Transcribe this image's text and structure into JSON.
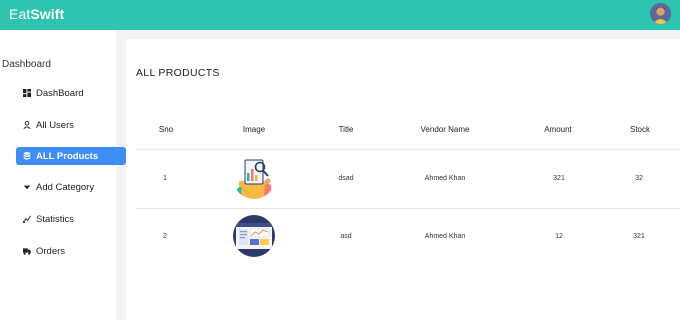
{
  "header": {
    "brand_prefix": "Eat",
    "brand_suffix": "Swift",
    "accent_color": "#2ec4b0"
  },
  "sidebar": {
    "heading": "Dashboard",
    "items": [
      {
        "label": "DashBoard",
        "icon": "grid-icon",
        "active": false
      },
      {
        "label": "All Users",
        "icon": "user-icon",
        "active": false
      },
      {
        "label": "ALL Products",
        "icon": "database-icon",
        "active": true
      },
      {
        "label": "Add Category",
        "icon": "caret-down-icon",
        "active": false
      },
      {
        "label": "Statistics",
        "icon": "chart-line-icon",
        "active": false
      },
      {
        "label": "Orders",
        "icon": "truck-icon",
        "active": false
      }
    ],
    "active_color": "#3f8cf2"
  },
  "main": {
    "title": "ALL PRODUCTS",
    "table": {
      "columns": [
        "Sno",
        "Image",
        "Title",
        "Vendor Name",
        "Amount",
        "Stock"
      ],
      "rows": [
        {
          "sno": "1",
          "image": "analytics-illustration",
          "title": "dsad",
          "vendor": "Ahmed Khan",
          "amount": "321",
          "stock": "32"
        },
        {
          "sno": "2",
          "image": "dashboard-screenshot",
          "title": "asd",
          "vendor": "Ahmed Khan",
          "amount": "12",
          "stock": "321"
        }
      ]
    }
  }
}
